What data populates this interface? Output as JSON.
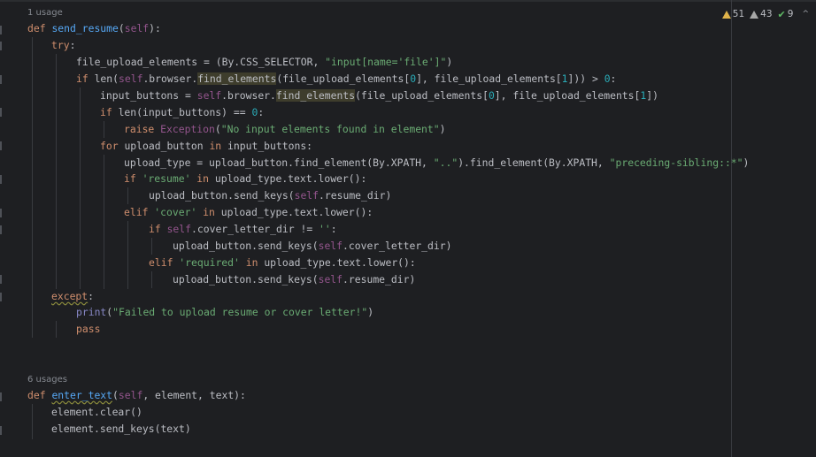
{
  "editor": {
    "usages_1": "1 usage",
    "usages_2": "6 usages"
  },
  "status": {
    "warnings": "51",
    "weak_warnings": "43",
    "typos": "9"
  },
  "code": {
    "l1": [
      "def",
      " ",
      "send_resume",
      "(",
      "self",
      "):"
    ],
    "l2": [
      "try",
      ":"
    ],
    "l3": [
      "file_upload_elements = (By.CSS_SELECTOR, ",
      "\"input[name='file']\"",
      ")"
    ],
    "l4": [
      "if ",
      "len",
      "(",
      "self",
      ".browser.",
      "find_elements",
      "(file_upload_elements[",
      "0",
      "], file_upload_elements[",
      "1",
      "])) > ",
      "0",
      ":"
    ],
    "l5": [
      "input_buttons = ",
      "self",
      ".browser.",
      "find_elements",
      "(file_upload_elements[",
      "0",
      "], file_upload_elements[",
      "1",
      "])"
    ],
    "l6": [
      "if ",
      "len",
      "(input_buttons) == ",
      "0",
      ":"
    ],
    "l7": [
      "raise ",
      "Exception",
      "(",
      "\"No input elements found in element\"",
      ")"
    ],
    "l8": [
      "for ",
      "upload_button ",
      "in ",
      "input_buttons:"
    ],
    "l9": [
      "upload_type = upload_button.find_element(By.XPATH, ",
      "\"..\"",
      ").find_element(By.XPATH, ",
      "\"preceding-sibling::*\"",
      ")"
    ],
    "l10": [
      "if ",
      "'resume'",
      " in ",
      "upload_type.text.lower():"
    ],
    "l11": [
      "upload_button.send_keys(",
      "self",
      ".resume_dir)"
    ],
    "l12": [
      "elif ",
      "'cover'",
      " in ",
      "upload_type.text.lower():"
    ],
    "l13": [
      "if ",
      "self",
      ".cover_letter_dir != ",
      "''",
      ":"
    ],
    "l14": [
      "upload_button.send_keys(",
      "self",
      ".cover_letter_dir)"
    ],
    "l15": [
      "elif ",
      "'required'",
      " in ",
      "upload_type.text.lower():"
    ],
    "l16": [
      "upload_button.send_keys(",
      "self",
      ".resume_dir)"
    ],
    "l17": [
      "except",
      ":"
    ],
    "l18": [
      "print",
      "(",
      "\"Failed to upload resume or cover letter!\"",
      ")"
    ],
    "l19": [
      "pass"
    ],
    "l20": [
      "def",
      " ",
      "enter_text",
      "(",
      "self",
      ", element, text):"
    ],
    "l21": [
      "element.clear()"
    ],
    "l22": [
      "element.send_keys(text)"
    ]
  }
}
